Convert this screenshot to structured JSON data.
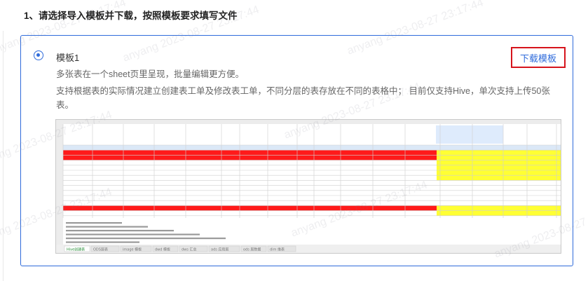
{
  "step": {
    "title": "1、请选择导入模板并下载，按照模板要求填写文件"
  },
  "template": {
    "name": "模板1",
    "download_label": "下载模板",
    "desc_line1": "多张表在一个sheet页里呈现，批量编辑更方便。",
    "desc_line2": "支持根据表的实际情况建立创建表工单及修改表工单，不同分层的表存放在不同的表格中； 目前仅支持Hive，单次支持上传50张表。"
  },
  "preview": {
    "sheet_tabs": [
      "Hive创建表",
      "ODS层表",
      "image 模板",
      "dwd 模板",
      "dws 汇总",
      "ads 应用层",
      "ods 层数据",
      "dim 维表"
    ],
    "colors": {
      "red": "#ff1a1a",
      "yellow": "#ffff33",
      "header_blue": "#dbe8f7",
      "selection": "#d0e3fb"
    }
  },
  "watermark": {
    "text": "anyang 2023-08-27 23:17:44"
  }
}
